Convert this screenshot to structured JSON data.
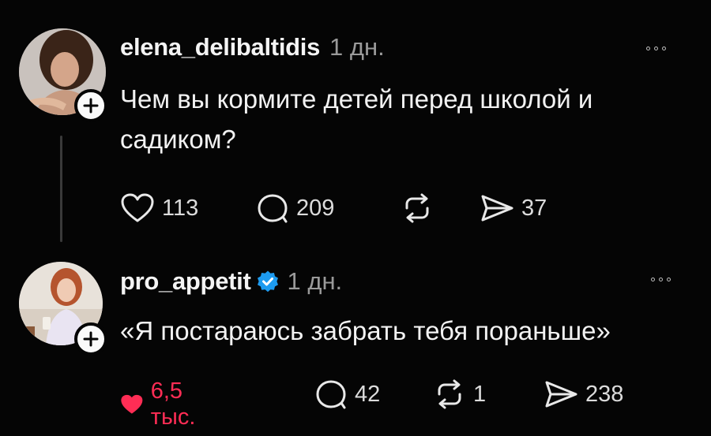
{
  "posts": [
    {
      "username": "elena_delibaltidis",
      "time": "1 дн.",
      "text_line1": "Чем вы кормите детей перед школой и",
      "text_line2": "садиком?",
      "likes": "113",
      "comments": "209",
      "reposts": "",
      "shares": "37",
      "verified": false,
      "liked": false
    },
    {
      "username": "pro_appetit",
      "time": "1 дн.",
      "text_line1": "«Я постараюсь забрать тебя пораньше»",
      "text_line2": "",
      "likes": "6,5 тыс.",
      "comments": "42",
      "reposts": "1",
      "shares": "238",
      "verified": true,
      "liked": true
    }
  ],
  "colors": {
    "background": "#050505",
    "like_active": "#ff2d55",
    "verified": "#1d9bf0",
    "muted": "#9a9a9a"
  },
  "icons": [
    "heart-icon",
    "comment-icon",
    "repost-icon",
    "share-icon",
    "more-icon",
    "plus-icon",
    "verified-badge-icon"
  ]
}
